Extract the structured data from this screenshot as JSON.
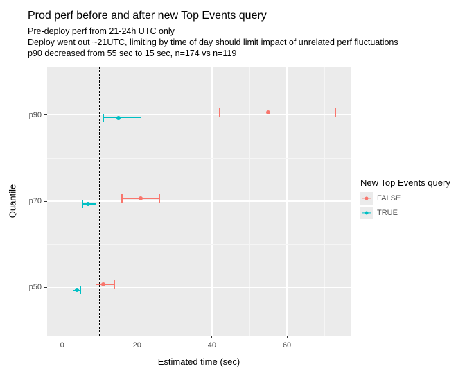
{
  "title": "Prod perf before and after new Top Events query",
  "subtitle": [
    "Pre-deploy perf from 21-24h UTC only",
    "Deploy went out ~21UTC, limiting by time of day should limit impact of unrelated perf fluctuations",
    "p90 decreased from 55 sec to 15 sec, n=174 vs n=119"
  ],
  "xlab": "Estimated time (sec)",
  "ylab": "Quantile",
  "legend": {
    "title": "New Top Events query",
    "items": [
      {
        "label": "FALSE",
        "color": "#F8766D"
      },
      {
        "label": "TRUE",
        "color": "#00BFC4"
      }
    ]
  },
  "axes": {
    "x": {
      "ticks": [
        0,
        20,
        40,
        60
      ],
      "range": [
        -4,
        77
      ]
    },
    "y": {
      "ticks": [
        "p50",
        "p70",
        "p90"
      ]
    }
  },
  "vline_x": 10,
  "chart_data": {
    "type": "errorbar",
    "x": "Estimated time (sec)",
    "y": "Quantile",
    "xlim": [
      -4,
      77
    ],
    "categories": [
      "p50",
      "p70",
      "p90"
    ],
    "series": [
      {
        "name": "FALSE",
        "color": "#F8766D",
        "points": [
          {
            "quantile": "p50",
            "est": 11,
            "lo": 9,
            "hi": 14
          },
          {
            "quantile": "p70",
            "est": 21,
            "lo": 16,
            "hi": 26
          },
          {
            "quantile": "p90",
            "est": 55,
            "lo": 42,
            "hi": 73
          }
        ]
      },
      {
        "name": "TRUE",
        "color": "#00BFC4",
        "points": [
          {
            "quantile": "p50",
            "est": 4,
            "lo": 3,
            "hi": 5
          },
          {
            "quantile": "p70",
            "est": 7,
            "lo": 5.5,
            "hi": 9
          },
          {
            "quantile": "p90",
            "est": 15,
            "lo": 11,
            "hi": 21
          }
        ]
      }
    ],
    "reference_line": 10
  }
}
